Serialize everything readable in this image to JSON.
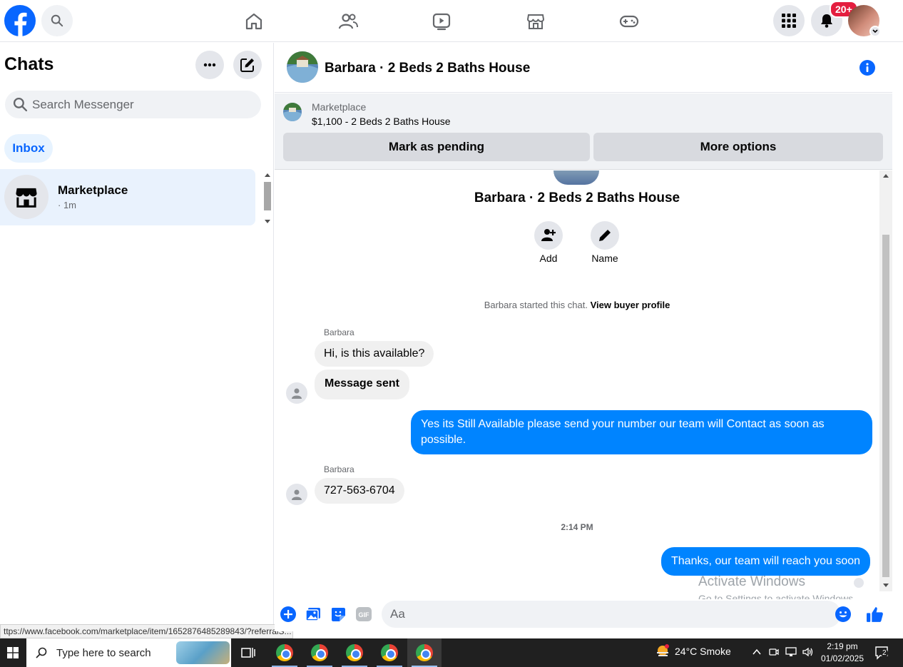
{
  "topbar": {
    "brand_icon": "facebook-logo",
    "nav_icons": [
      "home-icon",
      "friends-icon",
      "watch-icon",
      "marketplace-icon",
      "gaming-icon"
    ],
    "notification_badge": "20+"
  },
  "sidebar": {
    "title": "Chats",
    "search_placeholder": "Search Messenger",
    "filter_tab": "Inbox",
    "chats": [
      {
        "name": "Marketplace",
        "time": "· 1m"
      }
    ]
  },
  "conversation": {
    "title": "Barbara · 2 Beds 2 Baths House",
    "listing": {
      "source": "Marketplace",
      "title": "$1,100 - 2 Beds 2 Baths House",
      "primary_action": "Mark as pending",
      "secondary_action": "More options"
    },
    "thread_name": "Barbara · 2 Beds 2 Baths House",
    "actions": [
      {
        "label": "Add",
        "icon": "add-person-icon"
      },
      {
        "label": "Name",
        "icon": "pencil-icon"
      }
    ],
    "started_text": "Barbara started this chat.",
    "started_link": "View buyer profile",
    "messages": [
      {
        "sender": "Barbara",
        "text": "Hi, is this available?"
      },
      {
        "text": "Message sent"
      },
      {
        "outgoing": true,
        "text": "Yes its Still Available please send your number our team will Contact as soon as possible."
      },
      {
        "sender": "Barbara",
        "text": "727-563-6704"
      },
      {
        "outgoing": true,
        "text": "Thanks, our team will reach you soon"
      }
    ],
    "time_divider": "2:14 PM"
  },
  "composer": {
    "placeholder": "Aa"
  },
  "watermark": {
    "line1": "Activate Windows",
    "line2": "Go to Settings to activate Windows."
  },
  "status_url": "ttps://www.facebook.com/marketplace/item/1652876485289843/?referralS...",
  "taskbar": {
    "search_placeholder": "Type here to search",
    "weather": "24°C  Smoke",
    "time": "2:19 pm",
    "date": "01/02/2025",
    "notification_count": "2"
  },
  "colors": {
    "accent": "#0866ff",
    "outgoing_bubble": "#0084ff",
    "incoming_bubble": "#f0f0f0"
  }
}
